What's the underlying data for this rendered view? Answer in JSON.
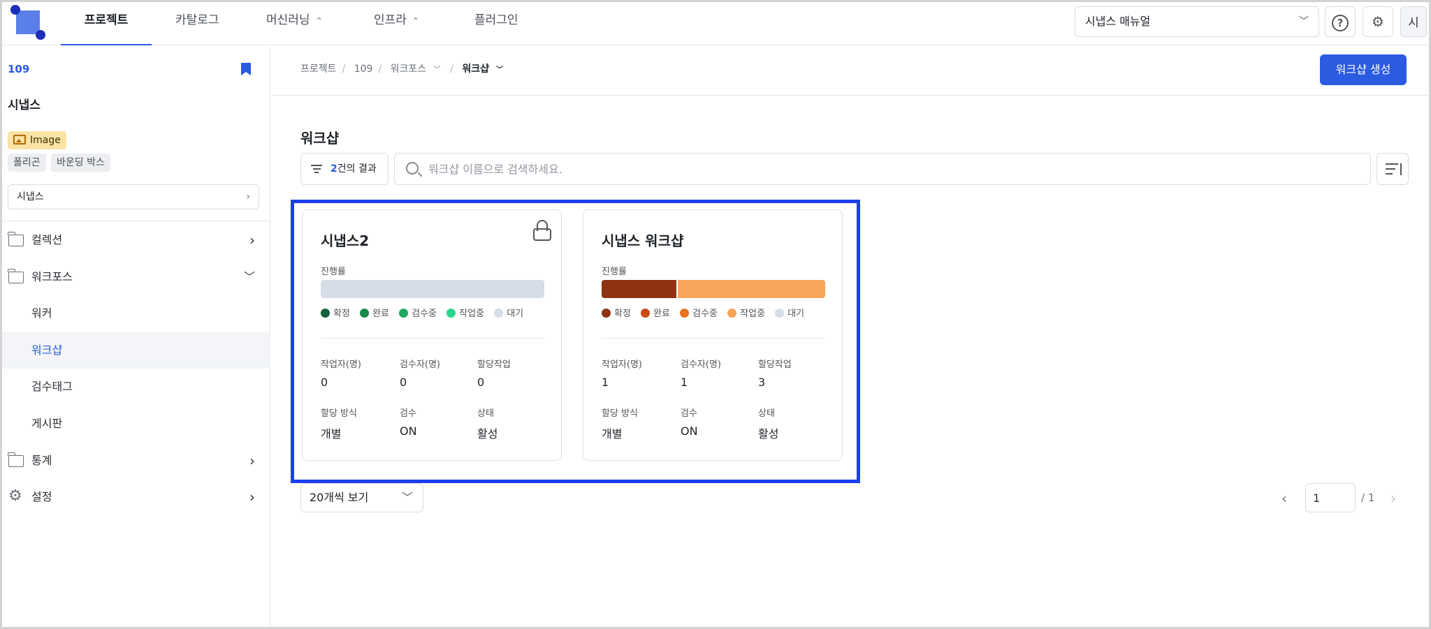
{
  "nav": {
    "tabs": [
      {
        "label": "프로젝트"
      },
      {
        "label": "카탈로그"
      },
      {
        "label": "머신러닝"
      },
      {
        "label": "인프라"
      },
      {
        "label": "플러그인"
      }
    ],
    "project_select": "시냅스 매뉴얼",
    "avatar": "시"
  },
  "sidebar": {
    "project_id": "109",
    "project_name": "시냅스",
    "type_badge": "Image",
    "tags": [
      "폴리곤",
      "바운딩 박스"
    ],
    "dataset_select": "시냅스",
    "menu": [
      {
        "label": "컬렉션"
      },
      {
        "label": "워크포스"
      },
      {
        "label": "워커"
      },
      {
        "label": "워크샵"
      },
      {
        "label": "검수태그"
      },
      {
        "label": "게시판"
      },
      {
        "label": "통계"
      },
      {
        "label": "설정"
      }
    ]
  },
  "breadcrumb": [
    "프로젝트",
    "109",
    "워크포스",
    "워크샵"
  ],
  "header": {
    "create_button": "워크샵 생성"
  },
  "page": {
    "title": "워크샵",
    "result_count": "2",
    "result_suffix": "건의 결과",
    "search_placeholder": "워크샵 이름으로 검색하세요."
  },
  "legend_labels": [
    "확정",
    "완료",
    "검수중",
    "작업중",
    "대기"
  ],
  "cards": [
    {
      "title": "시냅스2",
      "progress_label": "진행률",
      "locked": true,
      "progress": {
        "확정": 0,
        "완료": 0,
        "검수중": 0,
        "작업중": 0,
        "대기": 1
      },
      "legend_colors": [
        "#14613a",
        "#168a4a",
        "#22a85e",
        "#2bd68a",
        "#d6dde6"
      ],
      "stats": [
        {
          "label": "작업자(명)",
          "value": "0"
        },
        {
          "label": "검수자(명)",
          "value": "0"
        },
        {
          "label": "할당작업",
          "value": "0"
        },
        {
          "label": "할당 방식",
          "value": "개별"
        },
        {
          "label": "검수",
          "value": "ON"
        },
        {
          "label": "상태",
          "value": "활성"
        }
      ]
    },
    {
      "title": "시냅스 워크샵",
      "progress_label": "진행률",
      "locked": false,
      "progress": {
        "확정": 1,
        "완료": 0,
        "검수중": 0,
        "작업중": 2,
        "대기": 0
      },
      "legend_colors": [
        "#8e3312",
        "#c94a14",
        "#e8731f",
        "#f7a559",
        "#d6dde6"
      ],
      "stats": [
        {
          "label": "작업자(명)",
          "value": "1"
        },
        {
          "label": "검수자(명)",
          "value": "1"
        },
        {
          "label": "할당작업",
          "value": "3"
        },
        {
          "label": "할당 방식",
          "value": "개별"
        },
        {
          "label": "검수",
          "value": "ON"
        },
        {
          "label": "상태",
          "value": "활성"
        }
      ]
    }
  ],
  "pagination": {
    "page_size": "20개씩 보기",
    "current": "1",
    "total": "/ 1"
  },
  "colors": {
    "accent": "#2b5be0",
    "highlight": "#1a3ff0"
  }
}
